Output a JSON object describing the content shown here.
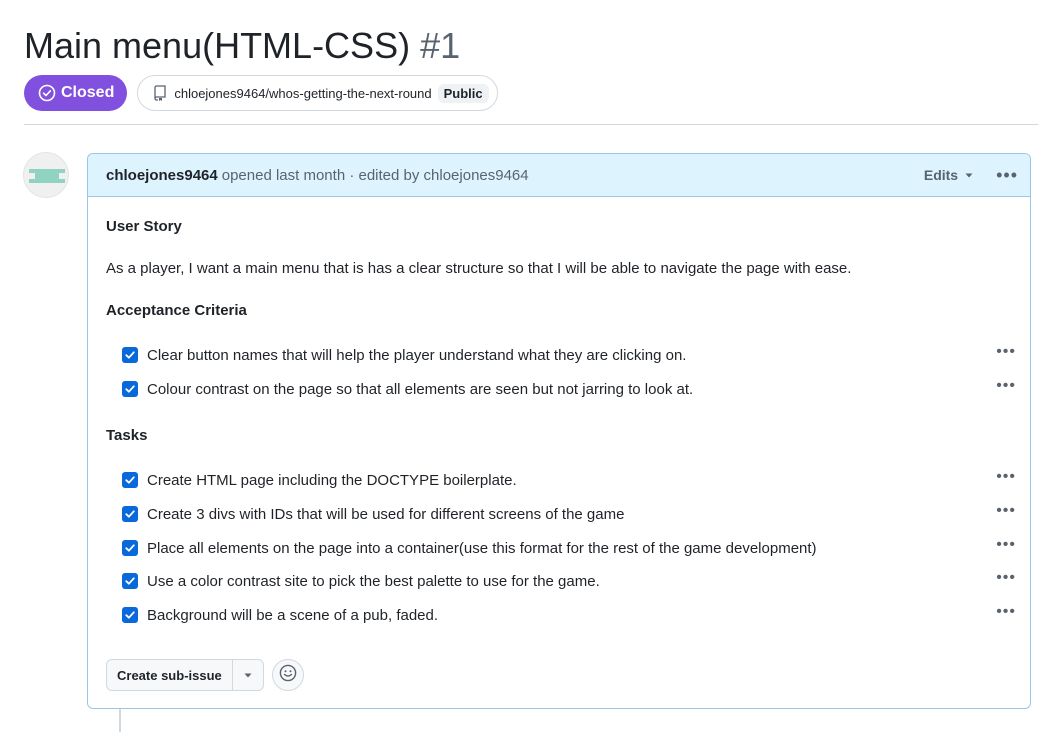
{
  "issue": {
    "title": "Main menu(HTML-CSS)",
    "number": "#1",
    "state": "Closed",
    "repo": "chloejones9464/whos-getting-the-next-round",
    "visibility": "Public"
  },
  "comment": {
    "author": "chloejones9464",
    "meta": "opened last month · edited by chloejones9464",
    "edits_label": "Edits",
    "sections": {
      "user_story_heading": "User Story",
      "user_story_text": "As a player, I want a main menu that is has a clear structure so that I will be able to navigate the page with ease.",
      "acceptance_heading": "Acceptance Criteria",
      "tasks_heading": "Tasks"
    },
    "acceptance_items": [
      {
        "label": "Clear button names that will help the player understand what they are clicking on.",
        "checked": true
      },
      {
        "label": "Colour contrast on the page so that all elements are seen but not jarring to look at.",
        "checked": true
      }
    ],
    "task_items": [
      {
        "label": "Create HTML page including the DOCTYPE boilerplate.",
        "checked": true
      },
      {
        "label": "Create 3 divs with IDs that will be used for different screens of the game",
        "checked": true
      },
      {
        "label": "Place all elements on the page into a container(use this format for the rest of the game development)",
        "checked": true
      },
      {
        "label": "Use a color contrast site to pick the best palette to use for the game.",
        "checked": true
      },
      {
        "label": "Background will be a scene of a pub, faded.",
        "checked": true
      }
    ],
    "footer": {
      "create_sub_issue_label": "Create sub-issue"
    }
  },
  "icons": {
    "state": "check-circle-icon",
    "repo": "repo-icon",
    "edits_caret": "triangle-down-icon",
    "more": "kebab-horizontal-icon",
    "emoji": "smiley-icon",
    "checkbox": "check-icon"
  },
  "colors": {
    "closed_purple": "#8250df",
    "header_bg": "#ddf4ff",
    "header_border": "#9ac7e8",
    "checkbox_blue": "#0969da",
    "avatar_teal": "#8fd3c0"
  }
}
